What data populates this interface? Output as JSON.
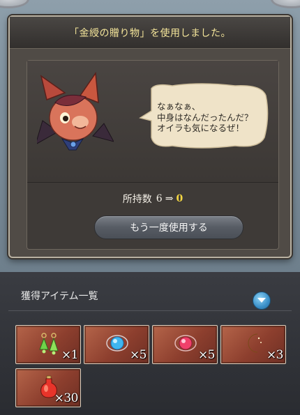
{
  "modal": {
    "title": "「金綬の贈り物」を使用しました。",
    "speech": {
      "line1": "なぁなぁ、",
      "line2": "中身はなんだったんだ？",
      "line3": "オイラも気になるぜ！"
    },
    "count": {
      "label": "所持数",
      "from": "6",
      "arrow": "⇒",
      "to": "0"
    },
    "reuse_button_label": "もう一度使用する"
  },
  "obtained": {
    "title": "獲得アイテム一覧",
    "toggle_icon": "chevron-down-icon",
    "items": [
      {
        "icon": "green-earrings-icon",
        "qty": "×1"
      },
      {
        "icon": "blue-orb-icon",
        "qty": "×5"
      },
      {
        "icon": "red-orb-icon",
        "qty": "×5"
      },
      {
        "icon": "crescent-moon-icon",
        "qty": "×3"
      },
      {
        "icon": "red-potion-icon",
        "qty": "×30"
      }
    ]
  },
  "colors": {
    "title_yellow": "#f4e59a",
    "count_highlight": "#f5d742",
    "tile_bg": "#8d3f2e"
  }
}
